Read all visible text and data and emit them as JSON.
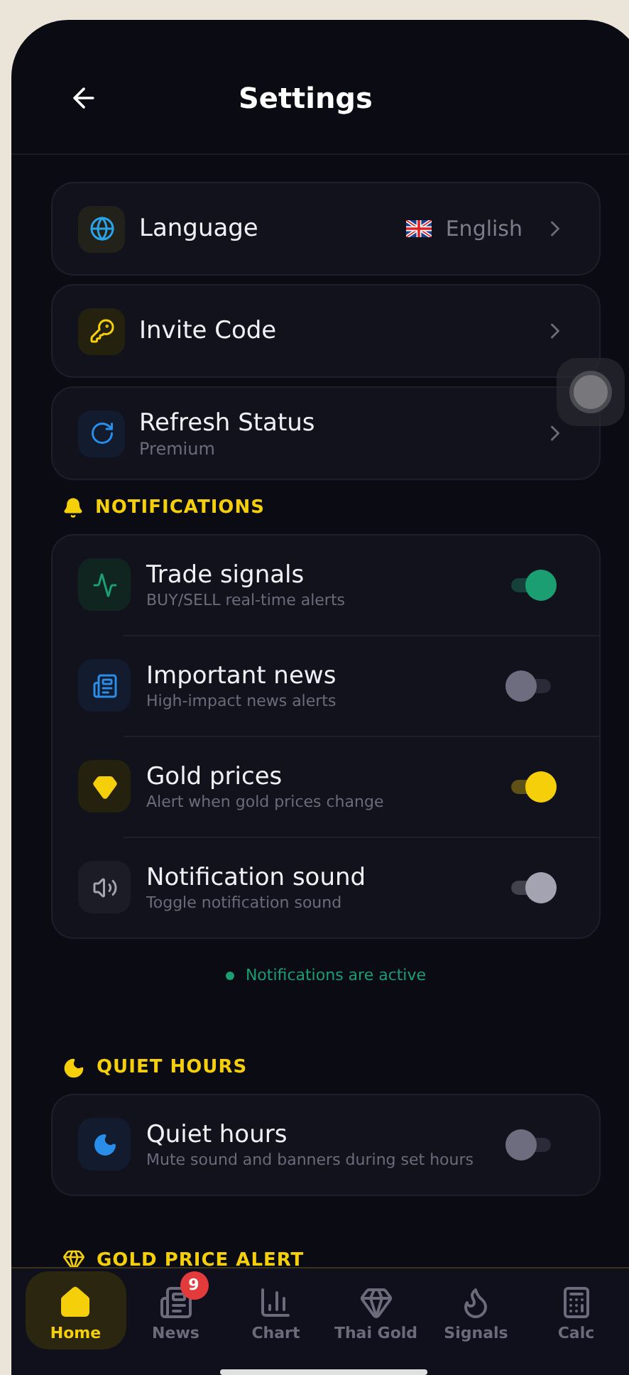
{
  "header": {
    "title": "Settings"
  },
  "menu_items": [
    {
      "kind": "language",
      "label": "Language",
      "value": "English"
    },
    {
      "kind": "invite",
      "label": "Invite Code"
    },
    {
      "kind": "refresh",
      "label": "Refresh Status",
      "subtitle": "Premium"
    }
  ],
  "notifications": {
    "title": "NOTIFICATIONS",
    "rows": [
      {
        "kind": "signals",
        "label": "Trade signals",
        "subtitle": "BUY/SELL real-time alerts",
        "on": true,
        "color": "#1a9e72"
      },
      {
        "kind": "news",
        "label": "Important news",
        "subtitle": "High-impact news alerts",
        "on": false,
        "color": "#2a8de8"
      },
      {
        "kind": "gold",
        "label": "Gold prices",
        "subtitle": "Alert when gold prices change",
        "on": true,
        "color": "#f5cf0a"
      },
      {
        "kind": "sound",
        "label": "Notification sound",
        "subtitle": "Toggle notification sound",
        "on": true,
        "color": "#a3a3b2"
      }
    ],
    "status": {
      "text": "Notifications are active",
      "active": true
    }
  },
  "quiet_hours": {
    "title": "QUIET HOURS",
    "rows": [
      {
        "kind": "moon",
        "label": "Quiet hours",
        "subtitle": "Mute sound and banners during set hours",
        "on": false,
        "color": "#2a8de8"
      }
    ]
  },
  "gold_alert": {
    "title": "GOLD PRICE ALERT"
  },
  "nav": [
    {
      "kind": "home",
      "label": "Home",
      "selected": true
    },
    {
      "kind": "news",
      "label": "News",
      "selected": false,
      "badge": "9"
    },
    {
      "kind": "chart",
      "label": "Chart",
      "selected": false
    },
    {
      "kind": "gem",
      "label": "Thai Gold",
      "selected": false
    },
    {
      "kind": "flame",
      "label": "Signals",
      "selected": false
    },
    {
      "kind": "calc",
      "label": "Calc",
      "selected": false
    }
  ]
}
